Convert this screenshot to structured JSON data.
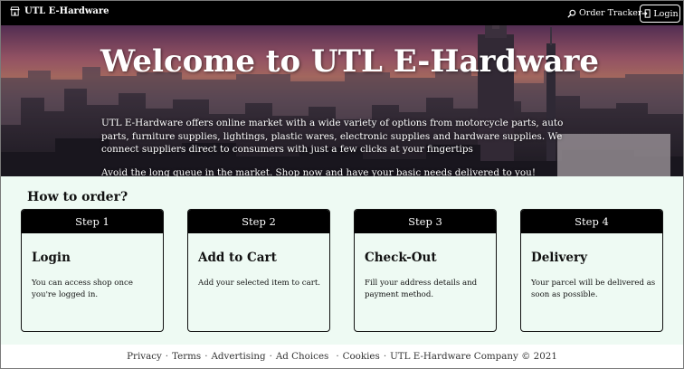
{
  "navbar": {
    "brand": "UTL E-Hardware",
    "brand_icon": "storefront-icon",
    "tracker_label": "Order Tracker",
    "tracker_icon": "search-icon",
    "login_label": "Login",
    "login_icon": "login-icon"
  },
  "hero": {
    "title": "Welcome to UTL E-Hardware",
    "description": "UTL E-Hardware offers online market with a wide variety of options from motorcycle parts, auto parts, furniture supplies, lightings, plastic wares, electronic supplies and hardware supplies. We connect suppliers direct to consumers with just a few clicks at your fingertips",
    "cta": "Avoid the long queue in the market. Shop now and have your basic needs delivered to you!"
  },
  "order": {
    "title": "How to order?",
    "steps": [
      {
        "label": "Step 1",
        "title": "Login",
        "text": "You can access shop once you're logged in."
      },
      {
        "label": "Step 2",
        "title": "Add to Cart",
        "text": "Add your selected item to cart."
      },
      {
        "label": "Step 3",
        "title": "Check-Out",
        "text": "Fill your address details and payment method."
      },
      {
        "label": "Step 4",
        "title": "Delivery",
        "text": "Your parcel will be delivered as soon as possible."
      }
    ]
  },
  "footer": {
    "links": [
      "Privacy",
      "Terms",
      "Advertising",
      "Ad Choices",
      "Cookies"
    ],
    "copyright": "UTL E-Hardware Company © 2021"
  },
  "colors": {
    "nav_bg": "#000000",
    "section_bg": "#eefaf3",
    "card_header_bg": "#000000"
  }
}
